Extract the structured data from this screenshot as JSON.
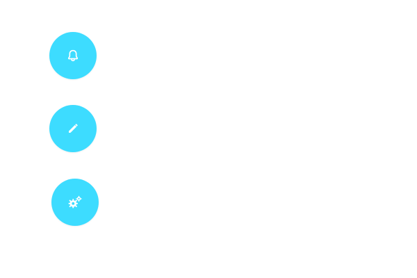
{
  "theme": {
    "button_color": "#3ddcff",
    "icon_color": "#ffffff",
    "background": "#ffffff"
  },
  "actions": [
    {
      "id": "notifications",
      "icon": "bell-icon"
    },
    {
      "id": "edit",
      "icon": "pencil-icon"
    },
    {
      "id": "settings",
      "icon": "gears-icon"
    }
  ]
}
